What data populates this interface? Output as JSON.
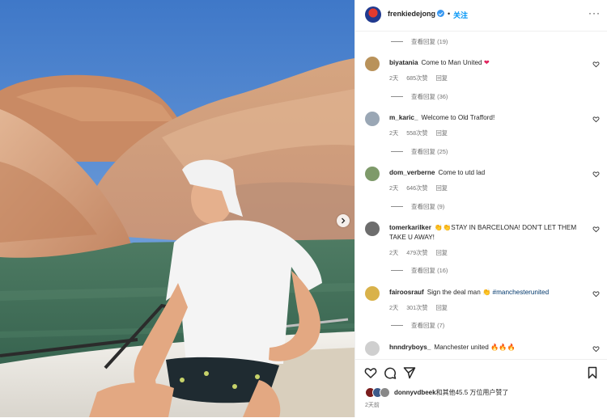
{
  "post": {
    "username": "frenkiedejong",
    "separator": "•",
    "follow_label": "关注",
    "more_label": "···"
  },
  "comments": [
    {
      "type": "view_replies",
      "label": "查看回复 (19)"
    },
    {
      "type": "comment",
      "username": "biyatania",
      "text": "Come to Man United ",
      "emoji": "❤",
      "time": "2天",
      "likes": "685次赞",
      "reply": "回复",
      "replies": "查看回复 (36)",
      "avatar_color": "#b9925a"
    },
    {
      "type": "comment",
      "username": "m_karic_",
      "text": "Welcome to Old Trafford!",
      "time": "2天",
      "likes": "558次赞",
      "reply": "回复",
      "replies": "查看回复 (25)",
      "avatar_color": "#9aa7b5"
    },
    {
      "type": "comment",
      "username": "dom_verberne",
      "text": "Come to utd lad",
      "time": "2天",
      "likes": "646次赞",
      "reply": "回复",
      "replies": "查看回复 (9)",
      "avatar_color": "#7e9a6a"
    },
    {
      "type": "comment",
      "username": "tomerkarilker",
      "text": "👏👏STAY IN BARCELONA! DON'T LET THEM TAKE U AWAY!",
      "time": "2天",
      "likes": "479次赞",
      "reply": "回复",
      "replies": "查看回复 (16)",
      "avatar_color": "#6d6d6d"
    },
    {
      "type": "comment",
      "username": "fairoosrauf",
      "text": "Sign the deal man 👏 ",
      "mention": "#manchesterunited",
      "time": "2天",
      "likes": "301次赞",
      "reply": "回复",
      "replies": "查看回复 (7)",
      "avatar_color": "#d9b24a"
    },
    {
      "type": "comment",
      "username": "hnndryboys_",
      "text": "Manchester united 🔥🔥🔥",
      "avatar_color": "#cfcfcf"
    }
  ],
  "likes": {
    "username": "donnyvdbeek",
    "rest": "和其他45.5 万位用户赞了"
  },
  "date": "2天前",
  "icons": [
    "heart-icon",
    "comment-icon",
    "share-icon",
    "bookmark-icon",
    "more-icon",
    "chevron-right-icon",
    "verified-icon"
  ],
  "colors": {
    "accent": "#0095f6",
    "verified": "#3897f0",
    "muted": "#737373",
    "text": "#262626"
  }
}
